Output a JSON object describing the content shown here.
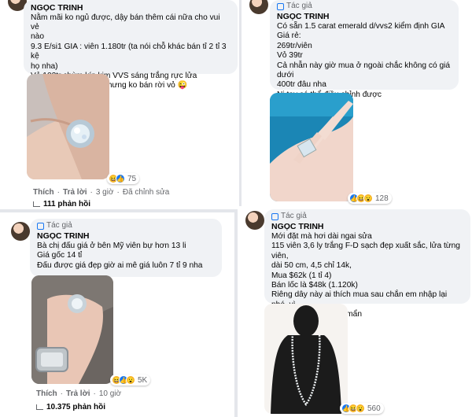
{
  "post1": {
    "name": "NGỌC TRINH",
    "lines": [
      "Nằm mãi ko ngủ được, dậy bán thêm cái nữa cho vui vẻ",
      "nào",
      "9.3 E/si1 GIA : viên 1.180tr (ta nói chỗ khác bán tỉ 2 tỉ 3 kệ",
      "họ nha)",
      "Vỏ 102tr chùm kín kim VVS sáng trắng rực lửa",
      "Có thể mua rời viên nhưng ko bán rời vỏ 😜"
    ],
    "reaction_count": "75",
    "action_like": "Thích",
    "action_reply": "Trả lời",
    "time": "3 giờ",
    "edited": "Đã chỉnh sửa",
    "replies": "111 phản hồi"
  },
  "post2": {
    "author_tag": "Tác giả",
    "name": "NGỌC TRINH",
    "lines": [
      "Có sẵn 1.5 carat emerald d/vvs2 kiểm định GIA",
      "Giá rẻ:",
      "269tr/viên",
      "Vỏ 39tr",
      "Cả nhẫn này giờ mua ở ngoài chắc không có giá dưới",
      "400tr đâu nha",
      "Ni tay có thể điều chỉnh được"
    ],
    "reaction_count": "128"
  },
  "post3": {
    "author_tag": "Tác giả",
    "name": "NGỌC TRINH",
    "lines": [
      "Bà chị đấu giá ở bên Mỹ viên bự hơn 13 li",
      "Giá gốc 14 tỉ",
      "Đấu được giá đẹp giờ ai mê giá luôn 7 tỉ 9 nha"
    ],
    "reaction_count": "5K",
    "action_like": "Thích",
    "action_reply": "Trả lời",
    "time": "10 giờ",
    "replies": "10.375 phản hồi"
  },
  "post4": {
    "author_tag": "Tác giả",
    "name": "NGỌC TRINH",
    "lines": [
      "Mới đặt mà hơi dài ngai sửa",
      "115 viên 3,6 ly trắng F-D sạch đẹp xuất sắc, lửa từng viên,",
      "dài 50 cm, 4,5 chỉ 14k,",
      "Mua $62k (1 tỉ 4)",
      "Bán lốc là $48k (1.120k)",
      "Riêng dây này ai thích mua sau chắn em nhập lại nhé, vì",
      "thực sự là rất rất mê mẩn"
    ],
    "reaction_count": "560"
  },
  "colors": {
    "page_bg": "#e4e6eb",
    "bubble": "#f0f2f5",
    "accent": "#1877f2"
  }
}
